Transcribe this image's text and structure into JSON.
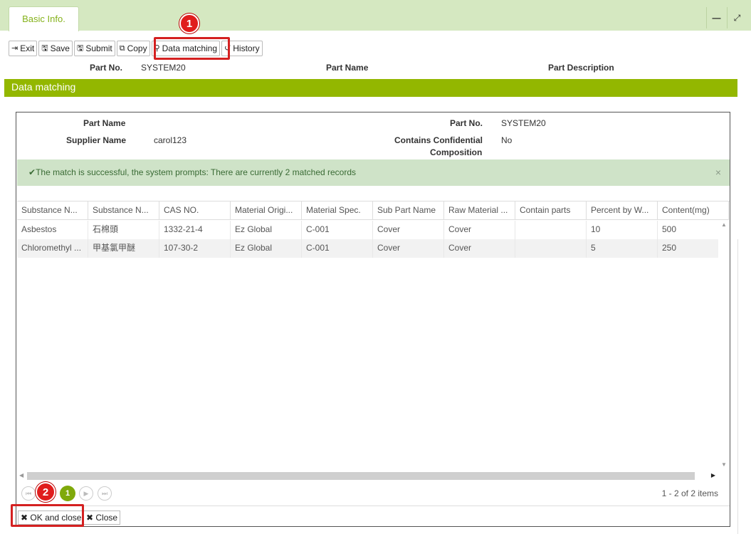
{
  "tabs": [
    {
      "label": "Basic Info."
    }
  ],
  "window": {
    "minimize": "—",
    "maximize": "⤢"
  },
  "toolbar": {
    "exit": "Exit",
    "save": "Save",
    "submit": "Submit",
    "copy": "Copy",
    "data_matching": "Data matching",
    "history": "History"
  },
  "header": {
    "part_no_label": "Part No.",
    "part_no_value": "SYSTEM20",
    "part_name_label": "Part Name",
    "part_desc_label": "Part Description"
  },
  "section_title": "Data matching",
  "dialog": {
    "part_name_label": "Part Name",
    "part_name_value": "",
    "part_no_label": "Part No.",
    "part_no_value": "SYSTEM20",
    "supplier_label": "Supplier Name",
    "supplier_value": "carol123",
    "confidential_label_1": "Contains Confidential",
    "confidential_label_2": "Composition",
    "confidential_value": "No",
    "message": "The match is successful, the system prompts: There are currently 2 matched records",
    "close_x": "×"
  },
  "grid": {
    "columns": [
      "Substance N...",
      "Substance N...",
      "CAS NO.",
      "Material Origi...",
      "Material Spec.",
      "Sub Part Name",
      "Raw Material ...",
      "Contain parts",
      "Percent by W...",
      "Content(mg)"
    ],
    "rows": [
      [
        "Asbestos",
        "石棉頭",
        "1332-21-4",
        "Ez Global",
        "C-001",
        "Cover",
        "Cover",
        "",
        "10",
        "500"
      ],
      [
        "Chloromethyl ...",
        "甲基氯甲醚",
        "107-30-2",
        "Ez Global",
        "C-001",
        "Cover",
        "Cover",
        "",
        "5",
        "250"
      ]
    ]
  },
  "pager": {
    "current": "1",
    "info": "1 - 2 of 2 items"
  },
  "footer": {
    "ok_close": "OK and close",
    "close": "Close"
  },
  "annotations": {
    "badge1": "1",
    "badge2": "2"
  },
  "colors": {
    "accent": "#93b700",
    "tab_bg": "#d5e8c1",
    "highlight": "#d42020",
    "success_bg": "#cfe3c8"
  }
}
